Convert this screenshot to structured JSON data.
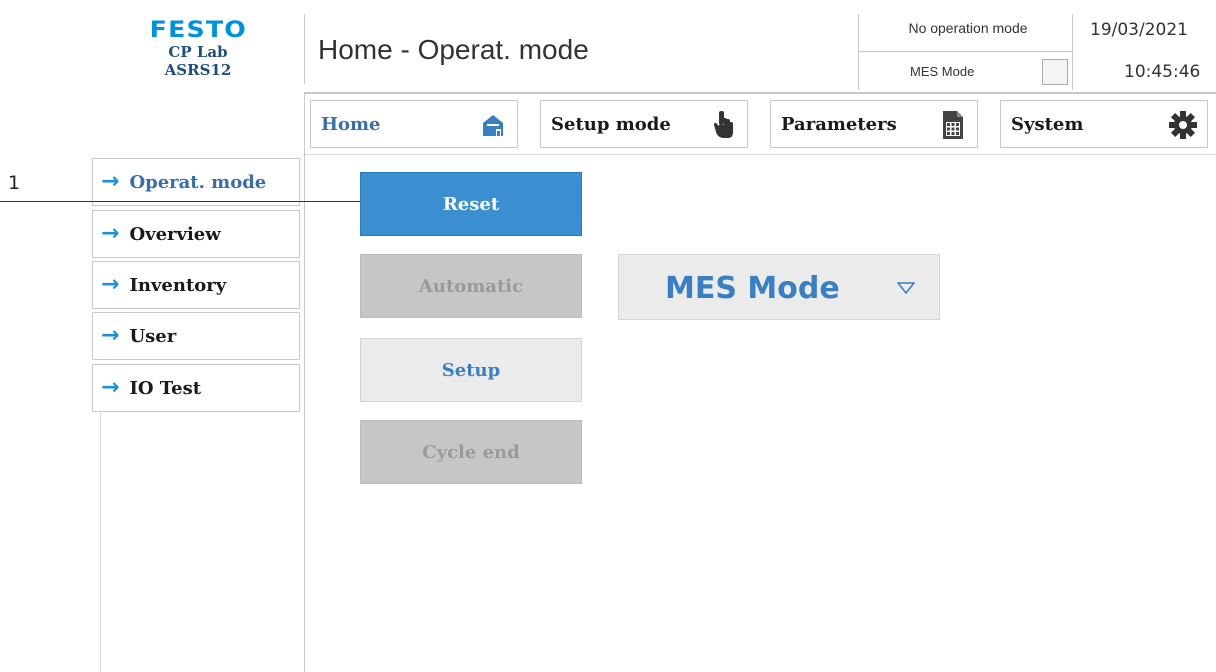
{
  "brand": {
    "logo": "FESTO",
    "line1": "CP Lab",
    "line2": "ASRS12"
  },
  "header": {
    "title": "Home - Operat. mode",
    "operation_mode": "No operation mode",
    "mes_label": "MES Mode",
    "date": "19/03/2021",
    "time": "10:45:46"
  },
  "nav": [
    {
      "label": "Home",
      "icon": "home-icon"
    },
    {
      "label": "Setup mode",
      "icon": "hand-pointer-icon"
    },
    {
      "label": "Parameters",
      "icon": "document-table-icon"
    },
    {
      "label": "System",
      "icon": "gear-icon"
    }
  ],
  "sidebar": {
    "items": [
      {
        "label": "Operat. mode"
      },
      {
        "label": "Overview"
      },
      {
        "label": "Inventory"
      },
      {
        "label": "User"
      },
      {
        "label": "IO Test"
      }
    ]
  },
  "annotation": {
    "number": "1"
  },
  "main": {
    "reset": "Reset",
    "automatic": "Automatic",
    "setup": "Setup",
    "cycle_end": "Cycle end"
  },
  "dropdown": {
    "selected": "MES Mode"
  },
  "colors": {
    "accent_blue": "#3b8fd0",
    "brand_blue": "#0091dc",
    "disabled_gray": "#c6c6c6"
  }
}
